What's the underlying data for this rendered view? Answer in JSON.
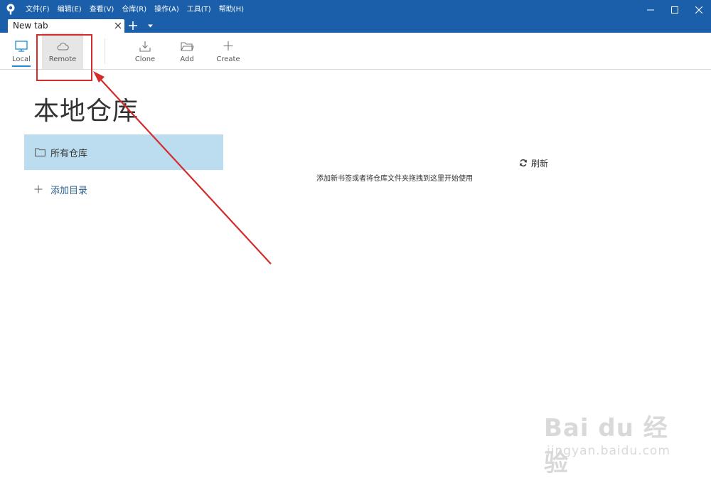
{
  "menu": [
    "文件(F)",
    "编辑(E)",
    "查看(V)",
    "仓库(R)",
    "操作(A)",
    "工具(T)",
    "帮助(H)"
  ],
  "tab": {
    "title": "New tab"
  },
  "toolbar": {
    "local": "Local",
    "remote": "Remote",
    "clone": "Clone",
    "add": "Add",
    "create": "Create"
  },
  "content": {
    "title": "本地仓库",
    "all_repos": "所有仓库",
    "add_directory": "添加目录",
    "refresh": "刷新",
    "empty_hint": "添加新书签或者将仓库文件夹拖拽到这里开始使用"
  },
  "watermark": {
    "brand": "Bai du 经验",
    "url": "jingyan.baidu.com"
  },
  "colors": {
    "titlebar": "#1b5faa",
    "selected_nav": "#bcddf0",
    "annotation": "#d42b2b",
    "accent": "#1f8bd6"
  },
  "icons": {
    "local": "monitor-icon",
    "remote": "cloud-icon",
    "clone": "download-icon",
    "add": "folder-open-icon",
    "create": "plus-icon",
    "all_repos": "folder-icon",
    "add_directory": "plus-icon",
    "refresh": "refresh-icon"
  }
}
